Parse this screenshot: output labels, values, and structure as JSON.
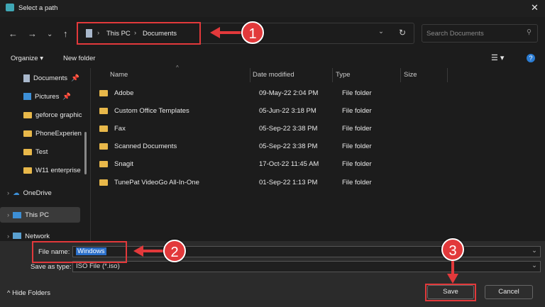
{
  "window": {
    "title": "Select a path"
  },
  "address": {
    "segments": [
      "This PC",
      "Documents"
    ]
  },
  "search": {
    "placeholder": "Search Documents"
  },
  "toolbar": {
    "organize": "Organize",
    "new_folder": "New folder"
  },
  "sidebar": {
    "items": [
      {
        "label": "Documents",
        "icon": "document-icon",
        "pinned": true
      },
      {
        "label": "Pictures",
        "icon": "pictures-icon",
        "pinned": true
      },
      {
        "label": "geforce graphic",
        "icon": "folder-icon"
      },
      {
        "label": "PhoneExperien",
        "icon": "folder-icon"
      },
      {
        "label": "Test",
        "icon": "folder-icon"
      },
      {
        "label": "W11 enterprise",
        "icon": "folder-icon"
      },
      {
        "label": "OneDrive",
        "icon": "cloud-icon"
      },
      {
        "label": "This PC",
        "icon": "pc-icon",
        "selected": true
      },
      {
        "label": "Network",
        "icon": "network-icon"
      }
    ]
  },
  "columns": [
    "Name",
    "Date modified",
    "Type",
    "Size"
  ],
  "files": [
    {
      "name": "Adobe",
      "date": "09-May-22 2:04 PM",
      "type": "File folder"
    },
    {
      "name": "Custom Office Templates",
      "date": "05-Jun-22 3:18 PM",
      "type": "File folder"
    },
    {
      "name": "Fax",
      "date": "05-Sep-22 3:38 PM",
      "type": "File folder"
    },
    {
      "name": "Scanned Documents",
      "date": "05-Sep-22 3:38 PM",
      "type": "File folder"
    },
    {
      "name": "Snagit",
      "date": "17-Oct-22 11:45 AM",
      "type": "File folder"
    },
    {
      "name": "TunePat VideoGo All-In-One",
      "date": "01-Sep-22 1:13 PM",
      "type": "File folder"
    }
  ],
  "form": {
    "file_name_label": "File name:",
    "file_name": "Windows",
    "type_label": "Save as type:",
    "type_value": "ISO File (*.iso)"
  },
  "buttons": {
    "save": "Save",
    "cancel": "Cancel",
    "hide_folders": "Hide Folders"
  },
  "annotations": [
    "1",
    "2",
    "3"
  ],
  "colors": {
    "annotation": "#e2393b",
    "folder": "#e8b84a"
  }
}
